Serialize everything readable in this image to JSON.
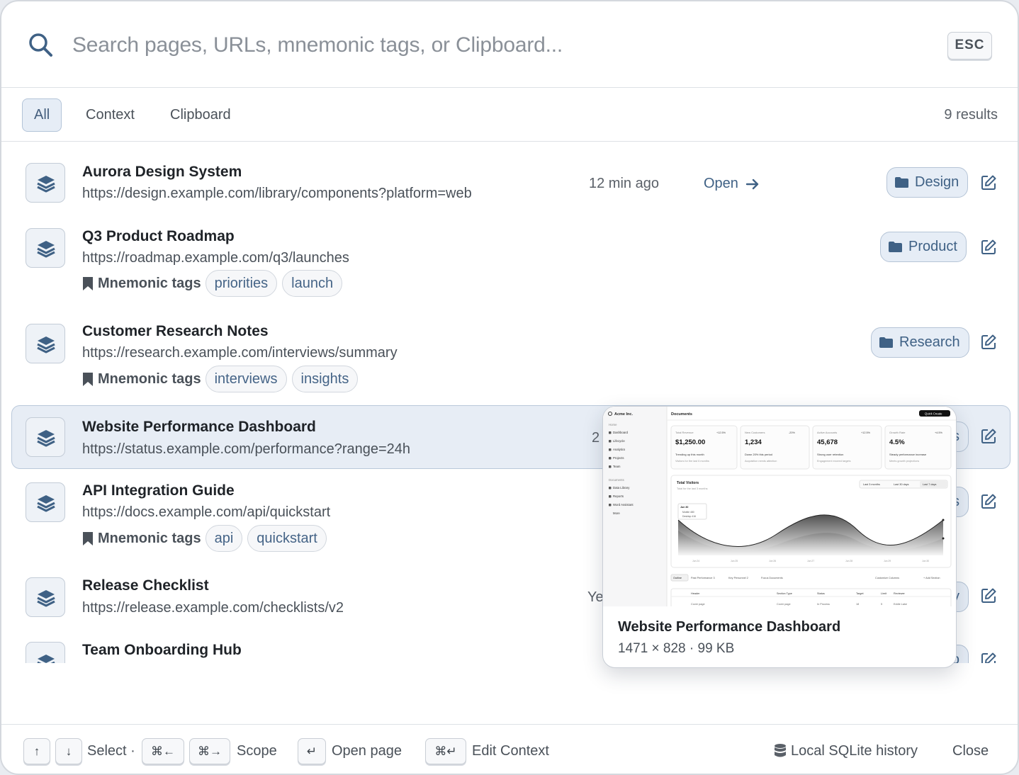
{
  "search": {
    "placeholder": "Search pages, URLs, mnemonic tags, or Clipboard...",
    "esc_label": "ESC"
  },
  "filters": {
    "tabs": [
      {
        "label": "All",
        "active": true
      },
      {
        "label": "Context",
        "active": false
      },
      {
        "label": "Clipboard",
        "active": false
      }
    ],
    "results_count": "9 results"
  },
  "tags_label": "Mnemonic tags",
  "results": [
    {
      "title": "Aurora Design System",
      "url": "https://design.example.com/library/components?platform=web",
      "time": "12 min ago",
      "action": "Open",
      "folder": "Design",
      "tags": []
    },
    {
      "title": "Q3 Product Roadmap",
      "url": "https://roadmap.example.com/q3/launches",
      "folder": "Product",
      "tags": [
        "priorities",
        "launch"
      ]
    },
    {
      "title": "Customer Research Notes",
      "url": "https://research.example.com/interviews/summary",
      "folder": "Research",
      "tags": [
        "interviews",
        "insights"
      ]
    },
    {
      "title": "Website Performance Dashboard",
      "url": "https://status.example.com/performance?range=24h",
      "time_partial": "2",
      "folder_partial": "s",
      "selected": true,
      "tags": []
    },
    {
      "title": "API Integration Guide",
      "url": "https://docs.example.com/api/quickstart",
      "folder_partial": "s",
      "tags": [
        "api",
        "quickstart"
      ]
    },
    {
      "title": "Release Checklist",
      "url": "https://release.example.com/checklists/v2",
      "time_partial": "Ye",
      "folder_partial": "y",
      "tags": []
    },
    {
      "title": "Team Onboarding Hub",
      "folder_partial": "o",
      "tags": []
    }
  ],
  "preview": {
    "title": "Website Performance Dashboard",
    "meta": "1471 × 828 · 99 KB",
    "thumb": {
      "brand": "Acme Inc.",
      "page": "Documents",
      "quick_create": "Quick Create",
      "nav": [
        "Home",
        "Dashboard",
        "Lifecycle",
        "Analytics",
        "Projects",
        "Team"
      ],
      "docs_heading": "Documents",
      "docs_nav": [
        "Data Library",
        "Reports",
        "Word Assistant",
        "More"
      ],
      "cards": [
        {
          "label": "Total Revenue",
          "value": "$1,250.00",
          "delta": "+12.5%",
          "note": "Trending up this month",
          "sub": "Visitors for the last 6 months"
        },
        {
          "label": "New Customers",
          "value": "1,234",
          "delta": "-20%",
          "note": "Down 20% this period",
          "sub": "Acquisition needs attention"
        },
        {
          "label": "Active Accounts",
          "value": "45,678",
          "delta": "+12.5%",
          "note": "Strong user retention",
          "sub": "Engagement exceed targets"
        },
        {
          "label": "Growth Rate",
          "value": "4.5%",
          "delta": "+4.5%",
          "note": "Steady performance increase",
          "sub": "Meets growth projections"
        }
      ],
      "visitors_title": "Total Visitors",
      "visitors_sub": "Total for the last 3 months",
      "ranges": [
        "Last 3 months",
        "Last 30 days",
        "Last 7 days"
      ],
      "tooltip": {
        "date": "Jun 30",
        "rows": [
          "Mobile  480",
          "Desktop  416"
        ]
      },
      "x_ticks": [
        "Jun 24",
        "Jun 25",
        "Jun 26",
        "Jun 27",
        "Jun 28",
        "Jun 29",
        "Jun 30"
      ],
      "table_tabs": [
        "Outline",
        "Past Performance 3",
        "Key Personnel 2",
        "Focus Documents"
      ],
      "table_buttons": [
        "Customize Columns",
        "+ Add Section"
      ],
      "table_head": [
        "Header",
        "Section Type",
        "Status",
        "Target",
        "Limit",
        "Reviewer"
      ],
      "table_row": [
        "Cover page",
        "Cover page",
        "In Process",
        "18",
        "5",
        "Eddie Lake"
      ]
    }
  },
  "footer": {
    "select_label": "Select ·",
    "scope_label": "Scope",
    "open_label": "Open page",
    "edit_label": "Edit Context",
    "keys": {
      "up": "↑",
      "down": "↓",
      "scope_left": "⌘←",
      "scope_right": "⌘→",
      "enter": "↵",
      "edit": "⌘↵"
    },
    "history_label": "Local SQLite history",
    "close_label": "Close"
  },
  "colors": {
    "accent": "#3f6185",
    "selected_bg": "#e7edf5",
    "badge_bg": "#e6edf6",
    "tag_text": "#456487"
  }
}
